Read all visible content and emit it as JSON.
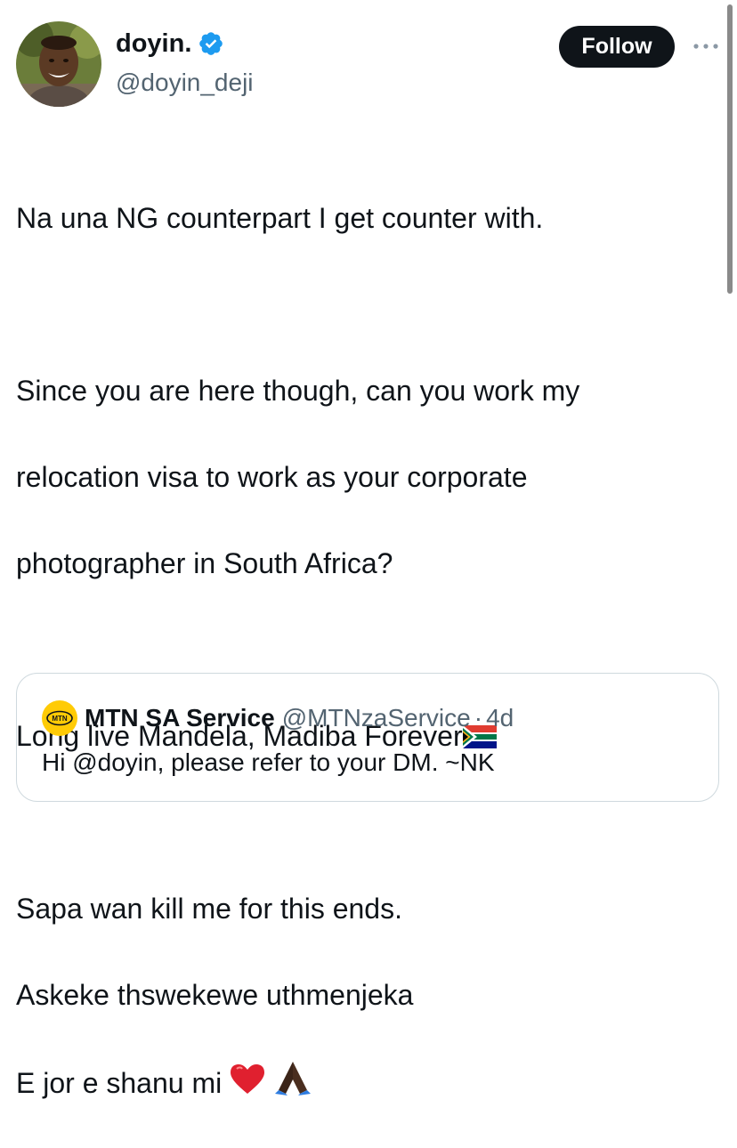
{
  "author": {
    "display_name": "doyin.",
    "handle": "@doyin_deji",
    "verified": true,
    "avatar_icon": "avatar-photo"
  },
  "follow_button_label": "Follow",
  "more_icon": "more-horizontal-icon",
  "tweet": {
    "lines": [
      "Na una NG counterpart I get counter with.",
      "",
      "Since you are here though, can you work my",
      "relocation visa to work as your corporate",
      "photographer in South Africa?",
      "",
      "Long live Mandela, Madiba Forever",
      "",
      "Sapa wan kill me for this ends.",
      "Askeke thswekewe uthmenjeka",
      "E jor e shanu mi"
    ],
    "emoji": {
      "line_7": "south-africa-flag-icon",
      "line_11": [
        "red-heart-icon",
        "folded-hands-icon"
      ]
    }
  },
  "quote": {
    "display_name": "MTN SA Service",
    "handle": "@MTNzaService",
    "separator": "·",
    "time": "4d",
    "text": "Hi @doyin, please refer to your DM. ~NK",
    "logo_text": "MTN",
    "logo_color": "#ffcb05"
  },
  "colors": {
    "text": "#0f1419",
    "secondary": "#536471",
    "verified": "#1d9bf0",
    "border": "#cfd9de"
  }
}
